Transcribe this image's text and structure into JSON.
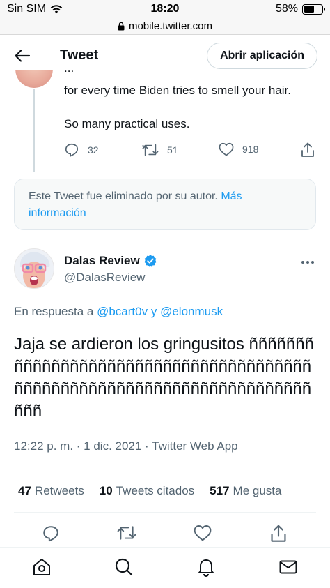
{
  "status_bar": {
    "carrier": "Sin SIM",
    "time": "18:20",
    "battery": "58%",
    "battery_level": 0.58
  },
  "browser": {
    "url": "mobile.twitter.com"
  },
  "header": {
    "title": "Tweet",
    "open_app_label": "Abrir aplicación"
  },
  "previous_tweet": {
    "text_line1_partial": "...",
    "text_line2": "for every time Biden tries to smell your hair.",
    "text_line3": "So many practical uses.",
    "replies": "32",
    "retweets": "51",
    "likes": "918"
  },
  "deleted_notice": {
    "text": "Este Tweet fue eliminado por su autor.",
    "link": "Más información"
  },
  "main_tweet": {
    "author_name": "Dalas Review",
    "author_handle": "@DalasReview",
    "reply_prefix": "En respuesta a",
    "reply_mention1": "@bcart0v",
    "reply_connector": "y",
    "reply_mention2": "@elonmusk",
    "text": "Jaja se ardieron los gringusitos ññññññññññññññññññññññññññññññññññññññññññññññññññññññññññññññññññññññññññ",
    "timestamp": "12:22 p. m. · 1 dic. 2021 · Twitter Web App",
    "stats": {
      "retweets_count": "47",
      "retweets_label": "Retweets",
      "quotes_count": "10",
      "quotes_label": "Tweets citados",
      "likes_count": "517",
      "likes_label": "Me gusta"
    }
  },
  "colors": {
    "accent": "#1d9bf0",
    "text_primary": "#0f1419",
    "text_secondary": "#536471",
    "border": "#cfd9de"
  },
  "icons": [
    "wifi-icon",
    "lock-icon",
    "back-arrow-icon",
    "reply-icon",
    "retweet-icon",
    "like-icon",
    "share-icon",
    "verified-badge-icon",
    "more-icon",
    "home-icon",
    "search-icon",
    "notifications-icon",
    "messages-icon"
  ]
}
